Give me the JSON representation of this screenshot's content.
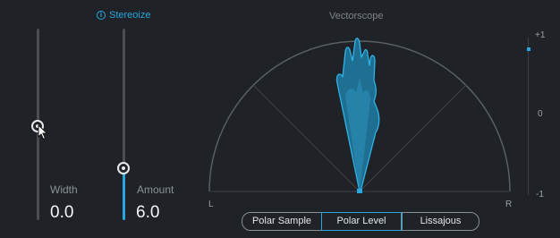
{
  "module": {
    "title": "Stereoize",
    "info_icon": "info-icon"
  },
  "width_control": {
    "label": "Width",
    "value": "0.0",
    "level": 0.0
  },
  "amount_control": {
    "label": "Amount",
    "value": "6.0",
    "level": 0.6
  },
  "vectorscope": {
    "title": "Vectorscope",
    "left_label": "L",
    "right_label": "R"
  },
  "correlation_meter": {
    "top_label": "+1",
    "mid_label": "0",
    "bottom_label": "-1"
  },
  "modes": {
    "items": [
      {
        "label": "Polar Sample",
        "active": false
      },
      {
        "label": "Polar Level",
        "active": true
      },
      {
        "label": "Lissajous",
        "active": false
      }
    ]
  },
  "colors": {
    "accent": "#27a7de",
    "background": "#1f2226",
    "track": "#4a4e54"
  }
}
